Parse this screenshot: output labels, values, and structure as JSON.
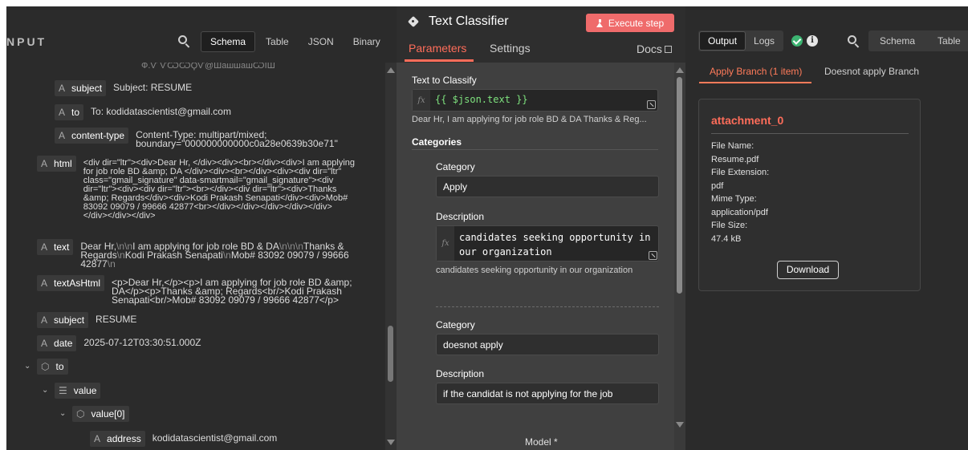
{
  "input_panel": {
    "title": "NPUT",
    "views": [
      "Schema",
      "Table",
      "JSON",
      "Binary"
    ],
    "cut_row_text": "Ф.Ѵ ѴѠѠϘѴ@ШашшашѠЇШ",
    "fields": [
      {
        "key": "subject",
        "value": "Subject: RESUME"
      },
      {
        "key": "to",
        "value": "To: kodidatascientist@gmail.com"
      },
      {
        "key": "content-type",
        "value": "Content-Type: multipart/mixed;\nboundary=\"000000000000c0a28e0639b30e71\""
      },
      {
        "key": "html",
        "value": "<div dir=\"ltr\"><div>Dear Hr, </div><div><br></div><div>I am applying for job role BD &amp; DA </div><div><br></div><div><div dir=\"ltr\" class=\"gmail_signature\" data-smartmail=\"gmail_signature\"><div dir=\"ltr\"><div><div dir=\"ltr\"><br></div><div dir=\"ltr\"><div>Thanks &amp; Regards</div><div>Kodi Prakash Senapati</div><div>Mob# 83092 09079 / 99666 42877<br></div></div></div></div></div></div></div></div>"
      },
      {
        "key": "text",
        "value_parts": [
          "Dear Hr,",
          "\\n",
          "\\n",
          "I am applying for job role BD & DA",
          "\\n",
          "\\n",
          "\\n",
          "Thanks & Regards",
          "\\n",
          "Kodi Prakash Senapati",
          "\\n",
          "Mob# 83092 09079 / 99666 42877",
          "\\n"
        ]
      },
      {
        "key": "textAsHtml",
        "value": "<p>Dear Hr,</p><p>I am applying for job role BD &amp; DA</p><p>Thanks &amp; Regards<br/>Kodi Prakash Senapati<br/>Mob# 83092 09079 / 99666 42877</p>"
      },
      {
        "key": "subject",
        "value": "RESUME"
      },
      {
        "key": "date",
        "value": "2025-07-12T03:30:51.000Z"
      }
    ],
    "tree": {
      "to_key": "to",
      "value_key": "value",
      "value0_key": "value[0]",
      "address_key": "address",
      "address_value": "kodidatascientist@gmail.com"
    }
  },
  "node_panel": {
    "title": "Text Classifier",
    "execute_label": "Execute step",
    "tabs": [
      "Parameters",
      "Settings"
    ],
    "docs_label": "Docs",
    "text_to_classify": {
      "label": "Text to Classify",
      "expression": "{{ $json.text }}",
      "preview": "Dear Hr, I am applying for job role BD & DA Thanks & Reg..."
    },
    "categories_label": "Categories",
    "categories": [
      {
        "category_label": "Category",
        "category_value": "Apply",
        "description_label": "Description",
        "description_value": "candidates seeking opportunity in our organization",
        "description_preview": "candidates seeking opportunity in our organization"
      },
      {
        "category_label": "Category",
        "category_value": "doesnot apply",
        "description_label": "Description",
        "description_value": "if the candidat is not applying for the job"
      }
    ],
    "model_label": "Model *"
  },
  "output_panel": {
    "toggle": [
      "Output",
      "Logs"
    ],
    "views": [
      "Schema",
      "Table"
    ],
    "branches": [
      "Apply Branch (1 item)",
      "Doesnot apply Branch"
    ],
    "attachment": {
      "title": "attachment_0",
      "fields": [
        {
          "label": "File Name:",
          "value": "Resume.pdf"
        },
        {
          "label": "File Extension:",
          "value": "pdf"
        },
        {
          "label": "Mime Type:",
          "value": "application/pdf"
        },
        {
          "label": "File Size:",
          "value": "47.4 kB"
        }
      ],
      "download_label": "Download"
    }
  },
  "colors": {
    "accent": "#ff6d5a",
    "execute_button": "#ef6b6b",
    "expression_green": "#7ee27e",
    "success_green": "#3cb371"
  },
  "icons": [
    "search-icon",
    "tag-icon",
    "flask-icon",
    "external-link-icon",
    "fx-icon",
    "expand-icon",
    "success-check-icon",
    "info-icon",
    "chevron-down-icon",
    "cube-icon",
    "list-icon",
    "type-a-icon"
  ]
}
